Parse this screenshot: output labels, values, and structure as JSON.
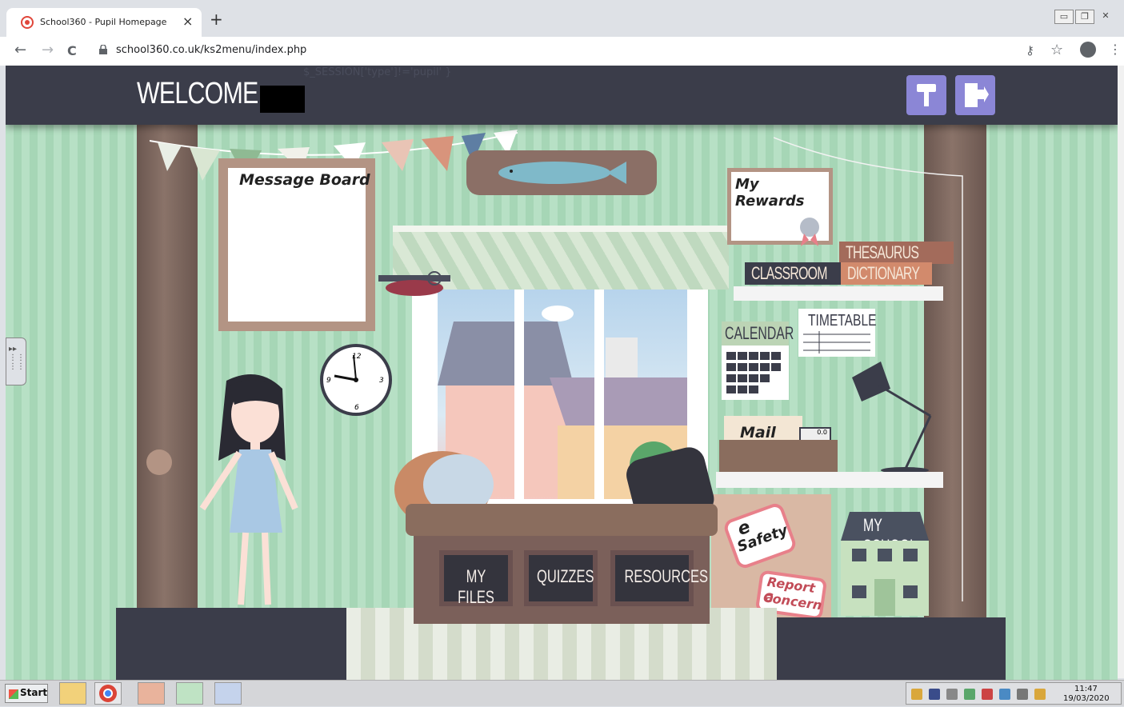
{
  "browser": {
    "tab_title": "School360 - Pupil Homepage",
    "tab_close": "×",
    "new_tab": "+",
    "url": "school360.co.uk/ks2menu/index.php",
    "nav_back": "←",
    "nav_forward": "→",
    "nav_reload": "C"
  },
  "header": {
    "welcome": "WELCOME,",
    "session_text": "$_SESSION['type']!='pupil' }"
  },
  "room": {
    "message_board": "Message Board",
    "my_rewards": "My Rewards",
    "books": {
      "thesaurus": "THESAURUS",
      "classroom": "CLASSROOM",
      "dictionary": "DICTIONARY"
    },
    "timetable": "TIMETABLE",
    "calendar": "CALENDAR",
    "mail": "Mail",
    "mail_counter": "0.0",
    "esafety_e": "e",
    "esafety_label": "Safety",
    "report_line1": "Report a",
    "report_line2": "Concern",
    "my_school": "MY SCHOOL",
    "drawers": {
      "my_files": "MY FILES",
      "quizzes": "QUIZZES",
      "resources": "RESOURCES"
    }
  },
  "taskbar": {
    "start": "Start",
    "time": "11:47",
    "date": "19/03/2020"
  },
  "colors": {
    "header_bg": "#3b3d4a",
    "header_button": "#8b86d6",
    "wall": "#b7e0c5"
  }
}
